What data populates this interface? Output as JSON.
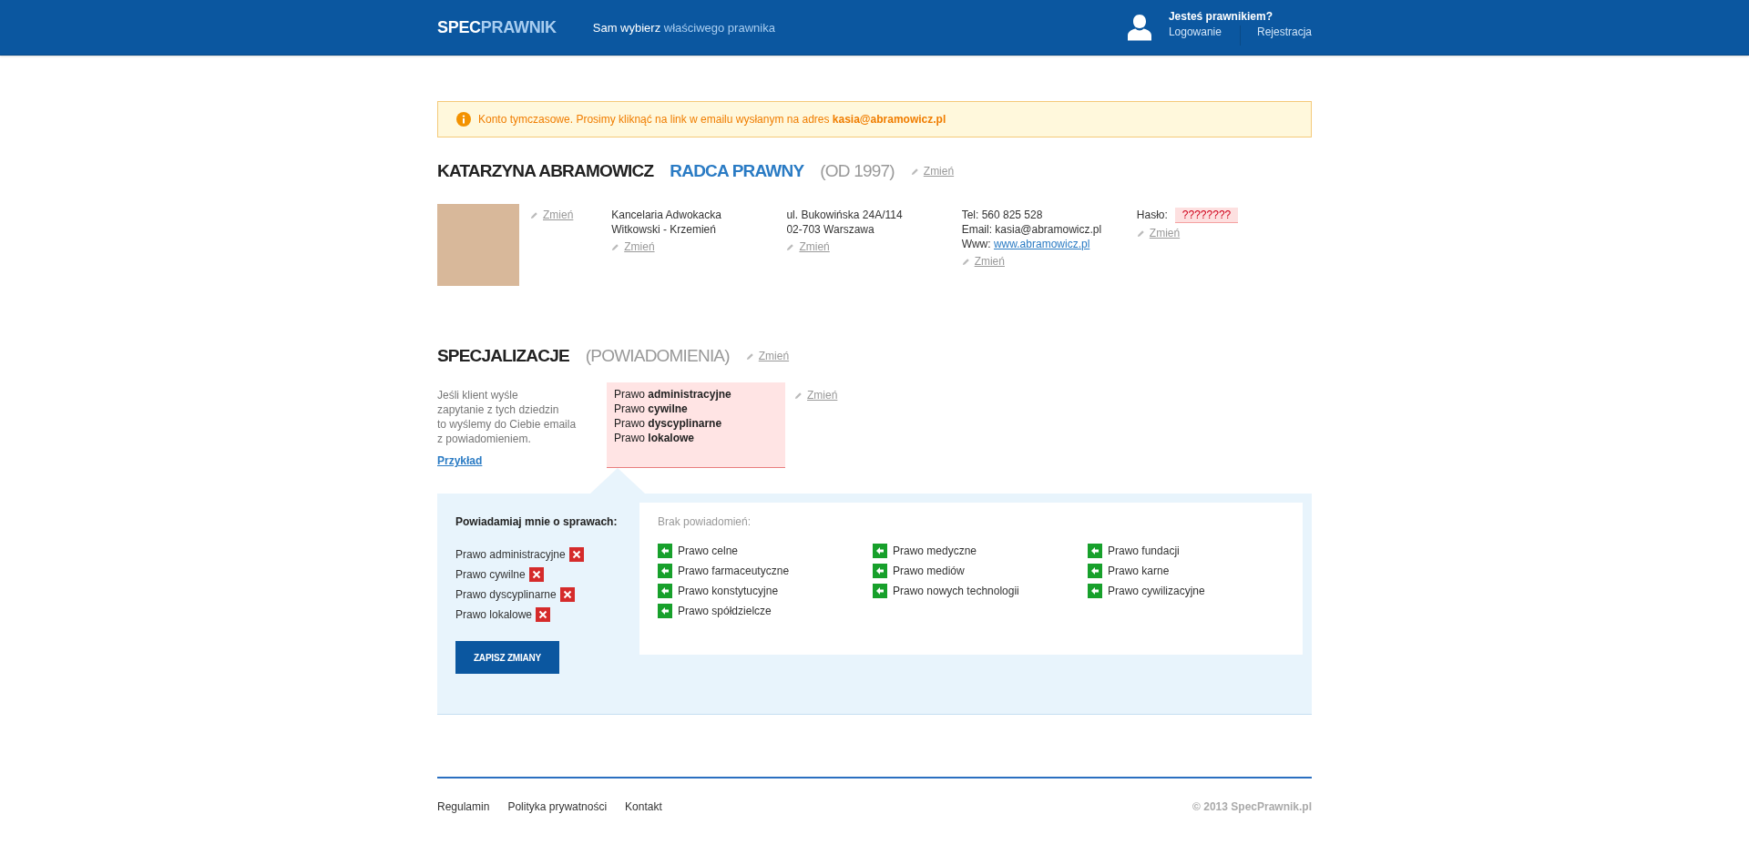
{
  "header": {
    "logo": {
      "part1": "SPEC",
      "part2": "PRAWNIK"
    },
    "tagline": {
      "lead": "Sam wybierz",
      "rest": "właściwego prawnika"
    },
    "account": {
      "question": "Jesteś prawnikiem?",
      "login": "Logowanie",
      "register": "Rejestracja"
    }
  },
  "alert": {
    "text": "Konto tymczasowe. Prosimy kliknąć na link w emailu wysłanym na adres **kasia@abramowicz.pl**"
  },
  "profile": {
    "name": "KATARZYNA ABRAMOWICZ",
    "title": "RADCA PRAWNY",
    "since": "(OD 1997)",
    "edit": "Zmień",
    "photo_edit": "Zmień",
    "office": {
      "lines": [
        "Kancelaria Adwokacka",
        "Witkowski - Krzemień"
      ],
      "edit": "Zmień"
    },
    "address": {
      "lines": [
        "ul. Bukowińska 24A/114",
        "02-703 Warszawa"
      ],
      "edit": "Zmień"
    },
    "contact": {
      "tel": "Tel: 560 825 528",
      "email": "Email: kasia@abramowicz.pl",
      "www_label": "Www:",
      "www": "www.abramowicz.pl",
      "edit": "Zmień"
    },
    "password": {
      "label": "Hasło:",
      "value": "????????",
      "edit": "Zmień"
    }
  },
  "specializations": {
    "heading": "SPECJALIZACJE",
    "subheading": "(POWIADOMIENIA)",
    "edit": "Zmień",
    "description": "Jeśli klient wyśle\nzapytanie z tych dziedzin\nto wyślemy do Ciebie emaila\nz powiadomieniem.",
    "example": "Przykład",
    "selected": [
      "Prawo **administracyjne**",
      "Prawo **cywilne**",
      "Prawo **dyscyplinarne**",
      "Prawo **lokalowe**"
    ],
    "selected_edit": "Zmień"
  },
  "notifications": {
    "heading": "Powiadamiaj mnie o sprawach:",
    "subscribed": [
      "Prawo administracyjne",
      "Prawo cywilne",
      "Prawo dyscyplinarne",
      "Prawo lokalowe"
    ],
    "save": "ZAPISZ ZMIANY",
    "empty": "Brak powiadomień:",
    "available": [
      [
        "Prawo celne",
        "Prawo farmaceutyczne",
        "Prawo konstytucyjne",
        "Prawo spółdzielcze"
      ],
      [
        "Prawo medyczne",
        "Prawo mediów",
        "Prawo nowych technologii"
      ],
      [
        "Prawo fundacji",
        "Prawo karne",
        "Prawo cywilizacyjne"
      ]
    ]
  },
  "footer": {
    "links": [
      "Regulamin",
      "Polityka prywatności",
      "Kontakt"
    ],
    "copyright": "© 2013 SpecPrawnik.pl"
  }
}
